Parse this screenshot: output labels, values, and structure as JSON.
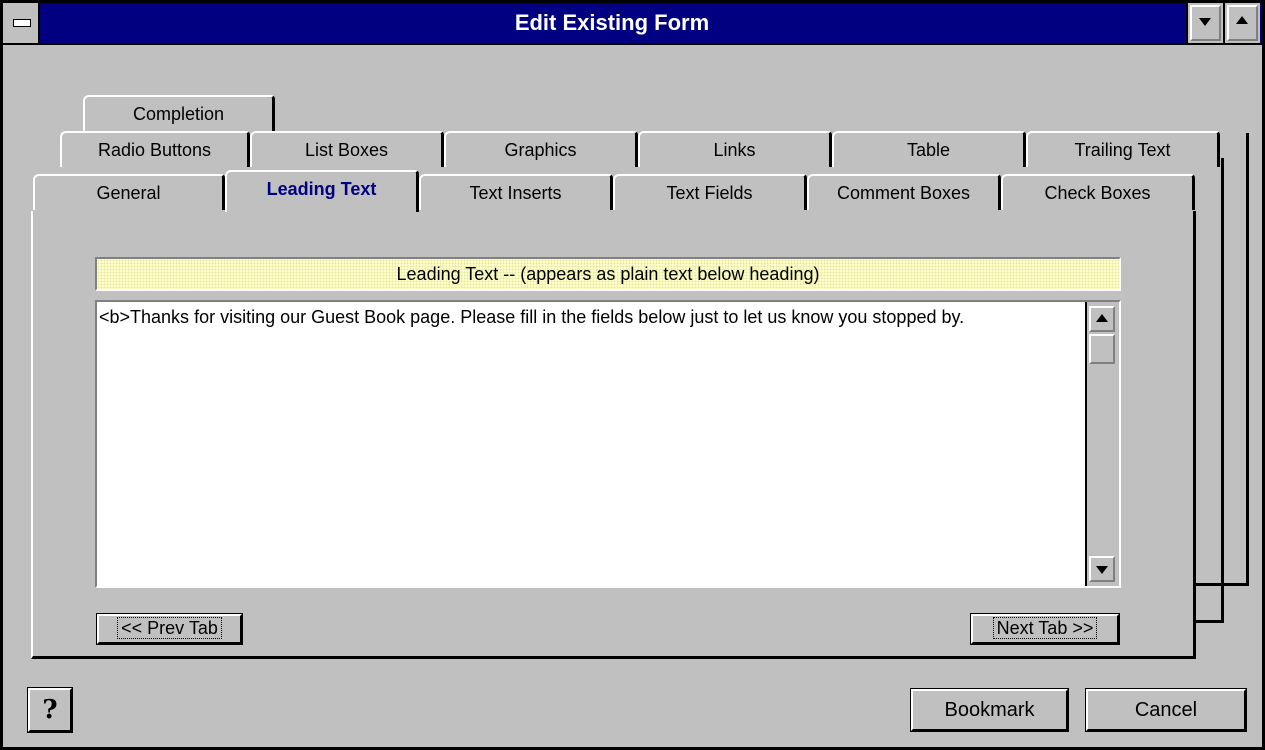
{
  "window": {
    "title": "Edit Existing Form"
  },
  "tabs": {
    "row1": [
      "Completion"
    ],
    "row2": [
      "Radio Buttons",
      "List Boxes",
      "Graphics",
      "Links",
      "Table",
      "Trailing Text"
    ],
    "row3": [
      "General",
      "Leading Text",
      "Text Inserts",
      "Text Fields",
      "Comment Boxes",
      "Check Boxes"
    ],
    "active": "Leading Text"
  },
  "panel": {
    "header": "Leading Text -- (appears as plain text below heading)",
    "text": "<b>Thanks for visiting our Guest Book page.  Please fill in the fields below just to let us know you stopped by.",
    "prev_label": "<< Prev Tab",
    "next_label": "Next Tab >>"
  },
  "footer": {
    "help_label": "?",
    "bookmark_label": "Bookmark",
    "cancel_label": "Cancel"
  },
  "icons": [
    "system-menu-icon",
    "minimize-icon",
    "maximize-icon",
    "help-icon",
    "scroll-up-icon",
    "scroll-down-icon"
  ],
  "colors": {
    "titlebar": "#000080",
    "face": "#c0c0c0",
    "active_tab_text": "#000080",
    "header_band": "#ffffc8"
  }
}
